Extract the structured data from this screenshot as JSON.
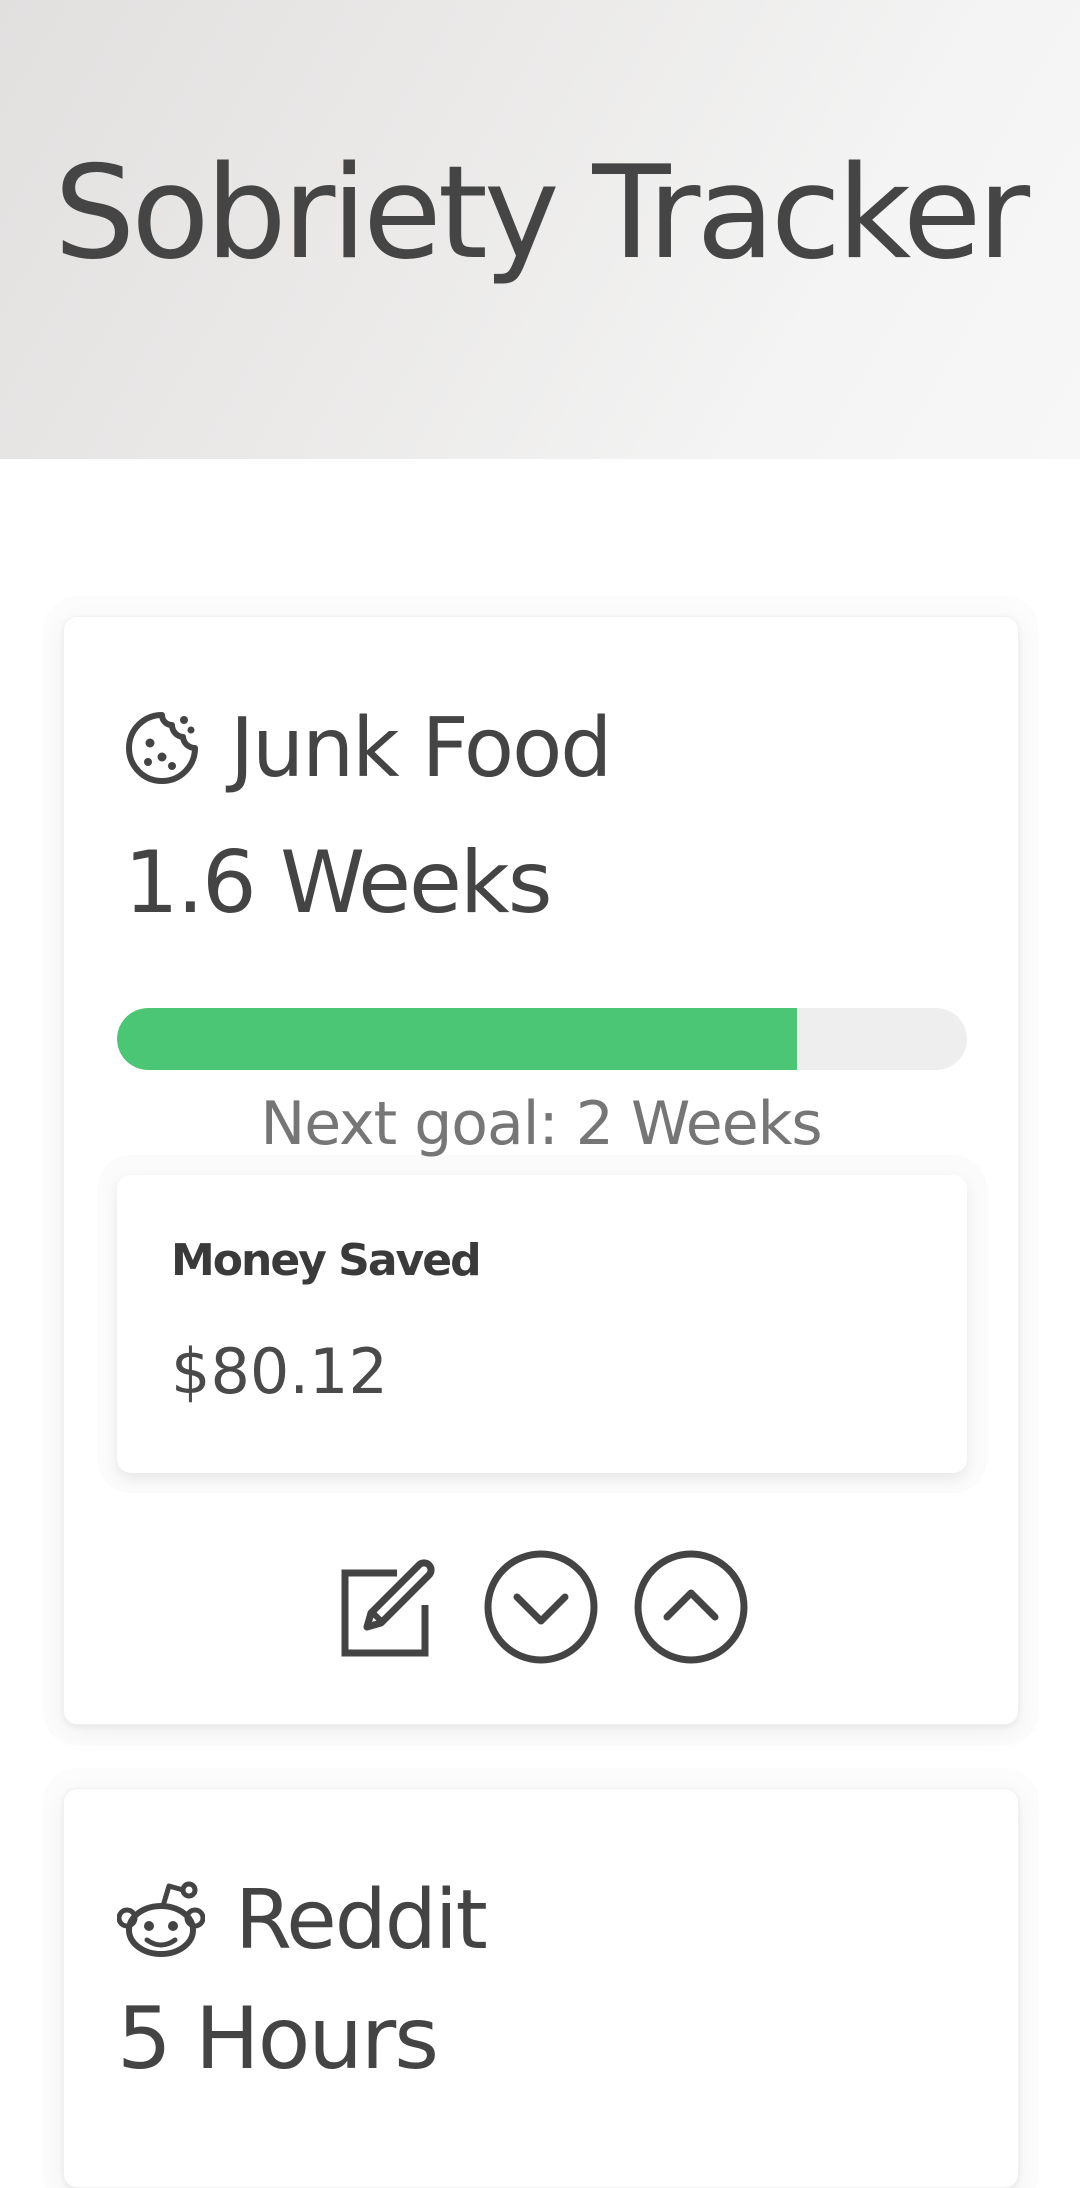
{
  "header": {
    "title": "Sobriety Tracker"
  },
  "trackers": [
    {
      "name": "Junk Food",
      "icon": "cookie-icon",
      "duration": "1.6 Weeks",
      "progress_fraction": 0.8,
      "next_goal": "Next goal: 2 Weeks",
      "money_saved_label": "Money Saved",
      "money_saved_value": "$80.12",
      "actions": [
        "edit-icon",
        "chevron-down-circle-icon",
        "chevron-up-circle-icon"
      ]
    },
    {
      "name": "Reddit",
      "icon": "reddit-icon",
      "duration": "5 Hours"
    }
  ],
  "colors": {
    "progress_fill": "#4ac675",
    "progress_track": "#eeeeee",
    "text": "#444444"
  }
}
